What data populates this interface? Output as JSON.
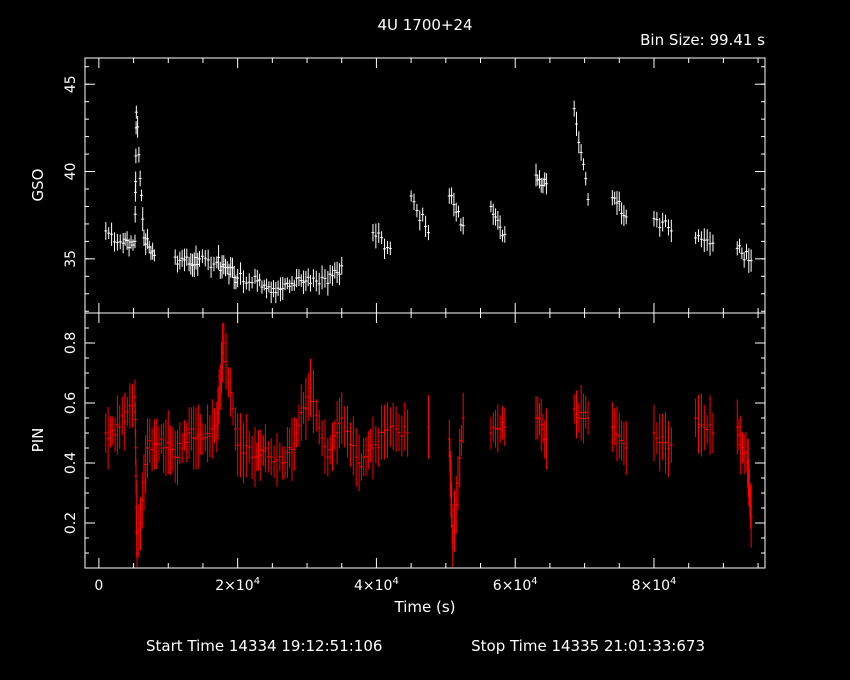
{
  "header": {
    "title": "4U 1700+24",
    "bin_size": "Bin Size: 99.41 s"
  },
  "footer": {
    "start_time": "Start Time 14334 19:12:51:106",
    "stop_time": "Stop Time 14335 21:01:33:673"
  },
  "colors": {
    "background": "#000000",
    "axes": "#ffffff",
    "gso_series": "#ffffff",
    "pin_series": "#ff0000"
  },
  "chart_data": [
    {
      "type": "scatter",
      "panel": "top",
      "ylabel": "GSO",
      "xlim": [
        -2000,
        96000
      ],
      "ylim": [
        31.9,
        46.5
      ],
      "yticks": [
        35,
        40,
        45
      ],
      "yticklabels": [
        "35",
        "40",
        "45"
      ],
      "series": [
        {
          "error_bars": true,
          "points": [
            [
              1000,
              36.6
            ],
            [
              3500,
              35.9
            ],
            [
              5200,
              36.0
            ],
            [
              5400,
              43.4
            ],
            [
              6500,
              36.2
            ],
            [
              8000,
              35.2
            ],
            [
              11000,
              35.1
            ],
            [
              13000,
              34.7
            ],
            [
              14500,
              35.0
            ],
            [
              17000,
              34.8
            ],
            [
              18500,
              34.5
            ],
            [
              20000,
              33.9
            ],
            [
              22500,
              34.0
            ],
            [
              24500,
              33.4
            ],
            [
              26500,
              33.3
            ],
            [
              28500,
              33.9
            ],
            [
              30500,
              33.6
            ],
            [
              33000,
              33.6
            ],
            [
              35000,
              34.6
            ],
            [
              39500,
              36.5
            ],
            [
              42000,
              35.6
            ],
            [
              45000,
              38.6
            ],
            [
              47500,
              36.5
            ],
            [
              50500,
              38.6
            ],
            [
              52500,
              36.9
            ],
            [
              56500,
              38.0
            ],
            [
              58500,
              36.4
            ],
            [
              63000,
              39.8
            ],
            [
              64500,
              39.3
            ],
            [
              68500,
              43.6
            ],
            [
              70500,
              38.4
            ],
            [
              74000,
              38.5
            ],
            [
              76000,
              37.4
            ],
            [
              80000,
              37.3
            ],
            [
              82500,
              36.6
            ],
            [
              86000,
              36.2
            ],
            [
              88500,
              35.9
            ],
            [
              92000,
              35.6
            ],
            [
              94000,
              34.9
            ]
          ]
        }
      ]
    },
    {
      "type": "scatter",
      "panel": "bottom",
      "xlabel": "Time (s)",
      "ylabel": "PIN",
      "xlim": [
        -2000,
        96000
      ],
      "ylim": [
        0.05,
        0.9
      ],
      "yticks": [
        0.2,
        0.4,
        0.6,
        0.8
      ],
      "yticklabels": [
        "0.2",
        "0.4",
        "0.6",
        "0.8"
      ],
      "xticks": [
        0,
        20000,
        40000,
        60000,
        80000
      ],
      "xticklabels": [
        {
          "base": "0",
          "exp": ""
        },
        {
          "base": "2×10",
          "exp": "4"
        },
        {
          "base": "4×10",
          "exp": "4"
        },
        {
          "base": "6×10",
          "exp": "4"
        },
        {
          "base": "8×10",
          "exp": "4"
        }
      ],
      "series": [
        {
          "error_bars": true,
          "points": [
            [
              1000,
              0.5
            ],
            [
              3000,
              0.52
            ],
            [
              5200,
              0.62
            ],
            [
              5500,
              0.1
            ],
            [
              7000,
              0.45
            ],
            [
              9000,
              0.48
            ],
            [
              11000,
              0.42
            ],
            [
              13000,
              0.5
            ],
            [
              15000,
              0.48
            ],
            [
              17000,
              0.52
            ],
            [
              18000,
              0.8
            ],
            [
              20000,
              0.46
            ],
            [
              22500,
              0.42
            ],
            [
              24000,
              0.45
            ],
            [
              26500,
              0.4
            ],
            [
              28500,
              0.5
            ],
            [
              30500,
              0.65
            ],
            [
              33000,
              0.42
            ],
            [
              35000,
              0.55
            ],
            [
              37500,
              0.4
            ],
            [
              39500,
              0.45
            ],
            [
              42000,
              0.52
            ],
            [
              44500,
              0.5
            ],
            [
              47500,
              0.52
            ],
            [
              50500,
              0.48
            ],
            [
              51000,
              0.12
            ],
            [
              52500,
              0.55
            ],
            [
              56500,
              0.5
            ],
            [
              58500,
              0.52
            ],
            [
              63000,
              0.55
            ],
            [
              64500,
              0.48
            ],
            [
              68500,
              0.58
            ],
            [
              70500,
              0.55
            ],
            [
              74000,
              0.52
            ],
            [
              76000,
              0.45
            ],
            [
              80000,
              0.5
            ],
            [
              82500,
              0.46
            ],
            [
              86000,
              0.55
            ],
            [
              88500,
              0.5
            ],
            [
              92000,
              0.52
            ],
            [
              93500,
              0.4
            ],
            [
              94000,
              0.22
            ]
          ]
        }
      ]
    }
  ]
}
